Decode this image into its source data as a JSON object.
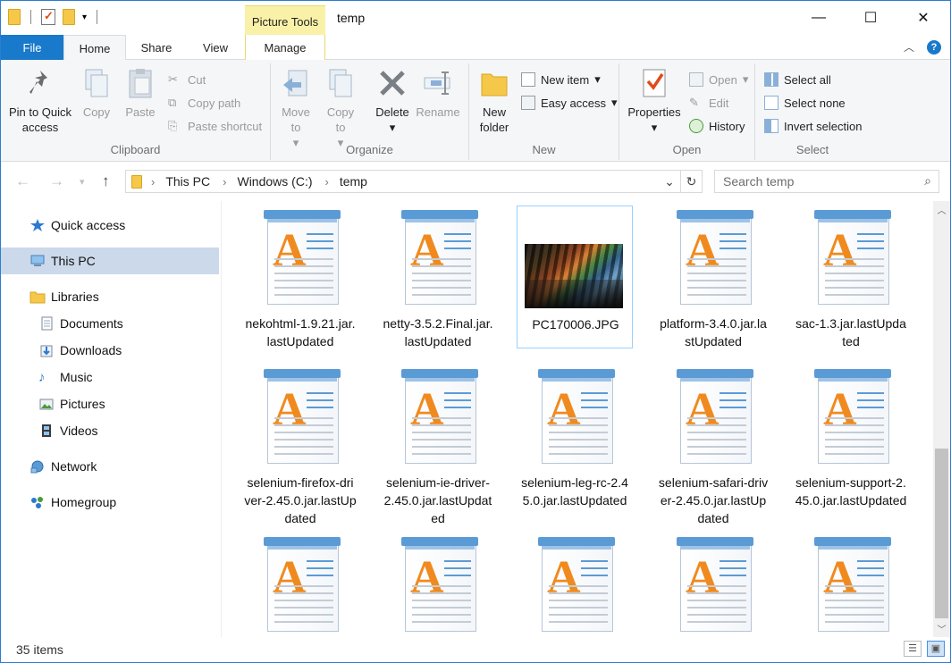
{
  "window": {
    "title": "temp",
    "context_tab": "Picture Tools",
    "controls": {
      "minimize": "—",
      "maximize": "☐",
      "close": "✕"
    }
  },
  "tabs": [
    {
      "label": "File"
    },
    {
      "label": "Home"
    },
    {
      "label": "Share"
    },
    {
      "label": "View"
    },
    {
      "label": "Manage"
    }
  ],
  "ribbon": {
    "clipboard": {
      "label": "Clipboard",
      "pin": "Pin to Quick access",
      "copy": "Copy",
      "paste": "Paste",
      "cut": "Cut",
      "copy_path": "Copy path",
      "paste_shortcut": "Paste shortcut"
    },
    "organize": {
      "label": "Organize",
      "move_to": "Move to",
      "copy_to": "Copy to",
      "delete": "Delete",
      "rename": "Rename"
    },
    "new": {
      "label": "New",
      "new_folder": "New folder",
      "new_item": "New item",
      "easy_access": "Easy access"
    },
    "open": {
      "label": "Open",
      "properties": "Properties",
      "open": "Open",
      "edit": "Edit",
      "history": "History"
    },
    "select": {
      "label": "Select",
      "select_all": "Select all",
      "select_none": "Select none",
      "invert": "Invert selection"
    }
  },
  "address": {
    "crumbs": [
      "This PC",
      "Windows (C:)",
      "temp"
    ],
    "search_placeholder": "Search temp"
  },
  "sidebar": [
    {
      "label": "Quick access",
      "icon": "star-icon"
    },
    {
      "label": "This PC",
      "icon": "computer-icon",
      "selected": true
    },
    {
      "label": "Libraries",
      "icon": "libraries-icon"
    },
    {
      "label": "Documents",
      "icon": "documents-icon"
    },
    {
      "label": "Downloads",
      "icon": "downloads-icon"
    },
    {
      "label": "Music",
      "icon": "music-icon"
    },
    {
      "label": "Pictures",
      "icon": "pictures-icon"
    },
    {
      "label": "Videos",
      "icon": "videos-icon"
    },
    {
      "label": "Network",
      "icon": "network-icon"
    },
    {
      "label": "Homegroup",
      "icon": "homegroup-icon"
    }
  ],
  "files": [
    {
      "name": "nekohtml-1.9.21.jar.lastUpdated",
      "type": "doc"
    },
    {
      "name": "netty-3.5.2.Final.jar.lastUpdated",
      "type": "doc"
    },
    {
      "name": "PC170006.JPG",
      "type": "image",
      "selected": true
    },
    {
      "name": "platform-3.4.0.jar.lastUpdated",
      "type": "doc"
    },
    {
      "name": "sac-1.3.jar.lastUpdated",
      "type": "doc"
    },
    {
      "name": "selenium-firefox-driver-2.45.0.jar.lastUpdated",
      "type": "doc"
    },
    {
      "name": "selenium-ie-driver-2.45.0.jar.lastUpdated",
      "type": "doc"
    },
    {
      "name": "selenium-leg-rc-2.45.0.jar.lastUpdated",
      "type": "doc"
    },
    {
      "name": "selenium-safari-driver-2.45.0.jar.lastUpdated",
      "type": "doc"
    },
    {
      "name": "selenium-support-2.45.0.jar.lastUpdated",
      "type": "doc"
    },
    {
      "name": "",
      "type": "doc"
    },
    {
      "name": "",
      "type": "doc"
    },
    {
      "name": "",
      "type": "doc"
    },
    {
      "name": "",
      "type": "doc"
    },
    {
      "name": "",
      "type": "doc"
    }
  ],
  "status": {
    "count": "35 items"
  },
  "colors": {
    "accent": "#1979ca",
    "selection": "#ccd9eb",
    "context_tab": "#faf1a8"
  }
}
